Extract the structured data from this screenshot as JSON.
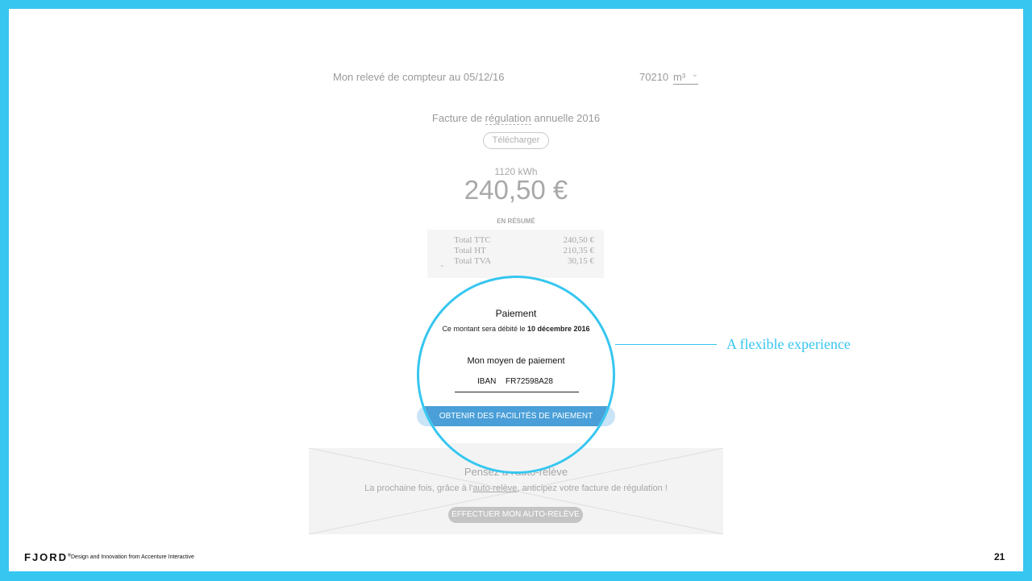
{
  "meter": {
    "label": "Mon relevé de compteur au 05/12/16",
    "value": "70210",
    "unit": "m³",
    "unit_chevron": "chevron-down-icon"
  },
  "invoice": {
    "title_prefix": "Facture de ",
    "title_link": "régulation",
    "title_suffix": " annuelle 2016",
    "download_label": "Télécharger",
    "kwh": "1120 kWh",
    "amount": "240,50 €",
    "summary_label": "EN RÉSUMÉ",
    "summary": [
      {
        "label": "Total TTC",
        "value": "240,50 €"
      },
      {
        "label": "Total HT",
        "value": "210,35 €"
      },
      {
        "label": "Total TVA",
        "value": "30,15 €"
      }
    ]
  },
  "payment": {
    "title": "Paiement",
    "subtitle_prefix": "Ce montant sera débité le ",
    "subtitle_date": "10 décembre 2016",
    "method_label": "Mon moyen de paiement",
    "iban_label": "IBAN",
    "iban_value": "FR72598A28",
    "button_label": "OBTENIR DES FACILITÉS DE PAIEMENT"
  },
  "banner": {
    "title": "Pensez à l'auto-relève",
    "text_prefix": "La prochaine fois, grâce à l'",
    "text_link": "auto-relève",
    "text_suffix": ", anticipez votre facture de régulation !",
    "button_label": "EFFECTUER MON AUTO-RELÈVE"
  },
  "callout": {
    "text": "A flexible experience",
    "color": "#36c6f0"
  },
  "footer": {
    "logo": "FJORD",
    "logo_mark": "®",
    "tagline": "Design and Innovation from Accenture Interactive",
    "page_number": "21"
  },
  "colors": {
    "frame": "#36c6f0",
    "pay_button": "#4a9fd8"
  }
}
